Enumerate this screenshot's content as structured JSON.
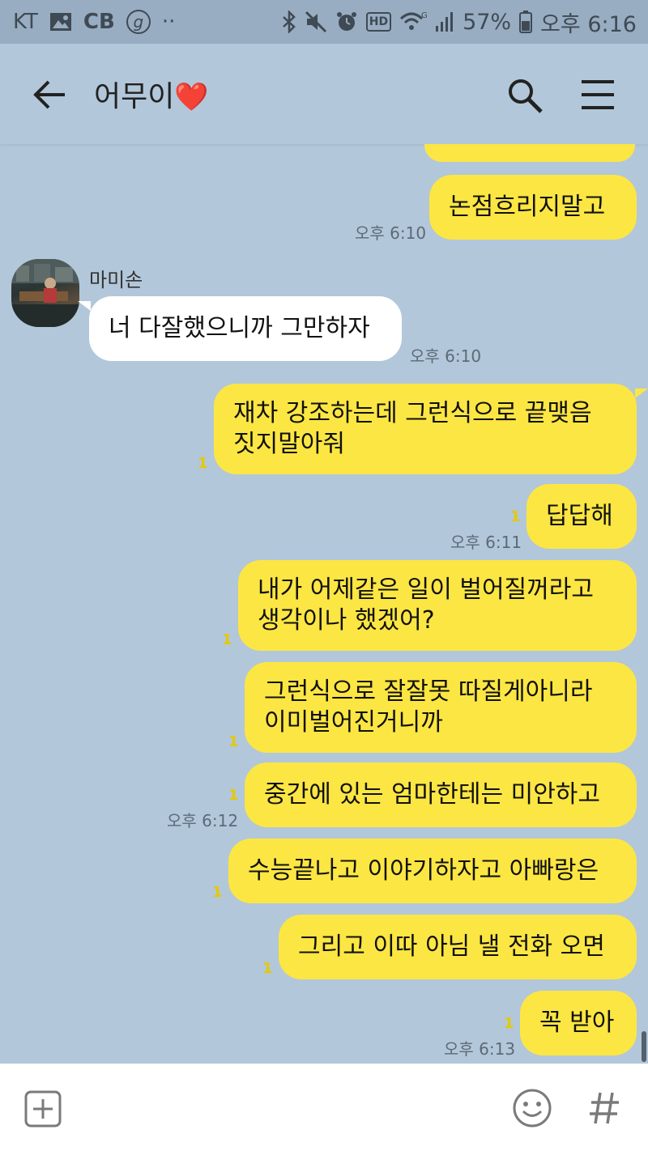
{
  "status_bar": {
    "carrier": "KT",
    "app_badge_cb": "CB",
    "app_badge_g": "g",
    "more": "··",
    "network": "HD",
    "battery": "57%",
    "time": "오후 6:16",
    "icons": [
      "gallery-icon",
      "bluetooth-icon",
      "mute-icon",
      "alarm-icon",
      "wifi-icon",
      "signal-icon",
      "battery-icon"
    ]
  },
  "header": {
    "title": "어무이",
    "title_emoji": "❤️"
  },
  "messages": [
    {
      "side": "me",
      "lines": [
        "논점흐리지말고"
      ],
      "time": "오후 6:10",
      "unread": ""
    },
    {
      "side": "them",
      "sender": "마미손",
      "lines": [
        "너 다잘했으니까 그만하자"
      ],
      "time": "오후 6:10"
    },
    {
      "side": "me",
      "lines": [
        "재차 강조하는데 그런식으로 끝맺음",
        "짓지말아줘"
      ],
      "time": "",
      "unread": "1"
    },
    {
      "side": "me",
      "lines": [
        "답답해"
      ],
      "time": "오후 6:11",
      "unread": "1"
    },
    {
      "side": "me",
      "lines": [
        "내가 어제같은 일이 벌어질꺼라고",
        "생각이나 했겠어?"
      ],
      "time": "",
      "unread": "1"
    },
    {
      "side": "me",
      "lines": [
        "그런식으로 잘잘못 따질게아니라",
        "이미벌어진거니까"
      ],
      "time": "",
      "unread": "1"
    },
    {
      "side": "me",
      "lines": [
        "중간에 있는 엄마한테는 미안하고"
      ],
      "time": "오후 6:12",
      "unread": "1"
    },
    {
      "side": "me",
      "lines": [
        "수능끝나고 이야기하자고 아빠랑은"
      ],
      "time": "",
      "unread": "1"
    },
    {
      "side": "me",
      "lines": [
        "그리고 이따 아님 낼 전화 오면"
      ],
      "time": "",
      "unread": "1"
    },
    {
      "side": "me",
      "lines": [
        "꼭 받아"
      ],
      "time": "오후 6:13",
      "unread": "1"
    }
  ],
  "colors": {
    "background": "#b2c7da",
    "my_bubble": "#fce643",
    "their_bubble": "#ffffff",
    "unread": "#e6c900"
  }
}
